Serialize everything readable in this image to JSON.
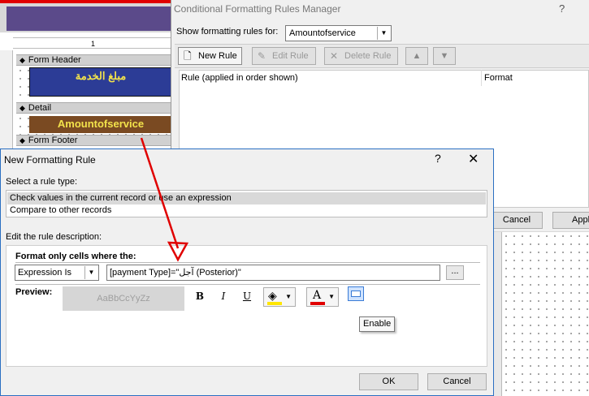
{
  "form_design": {
    "arabic_label": "مبلغ الخدمة",
    "field_label": "Amountofservice",
    "ruler_mark": "1",
    "sections": {
      "header": "Form Header",
      "detail": "Detail",
      "footer": "Form Footer"
    }
  },
  "rules_manager": {
    "title": "Conditional Formatting Rules Manager",
    "help": "?",
    "show_label": "Show formatting rules for:",
    "show_value": "Amountofservice",
    "toolbar": {
      "new_rule": "New Rule",
      "edit_rule": "Edit Rule",
      "delete_rule": "Delete Rule"
    },
    "columns": {
      "rule": "Rule (applied in order shown)",
      "format": "Format"
    },
    "cancel": "Cancel",
    "apply": "Apply"
  },
  "new_rule_dialog": {
    "title": "New Formatting Rule",
    "help": "?",
    "close": "✕",
    "select_rule_type_label": "Select a rule type:",
    "rule_types": [
      "Check values in the current record or use an expression",
      "Compare to other records"
    ],
    "selected_rule_type_index": 0,
    "edit_desc_label": "Edit the rule description:",
    "format_only_label": "Format only cells where the:",
    "condition_type": "Expression Is",
    "expression": "[payment Type]=\"آجل (Posterior)\"",
    "builder_label": "...",
    "preview_label": "Preview:",
    "preview_text": "AaBbCcYyZz",
    "bold": "B",
    "italic": "I",
    "underline": "U",
    "fill_color": "#ffe600",
    "font_color": "#e00000",
    "enable_tooltip": "Enable",
    "ok": "OK",
    "cancel": "Cancel"
  },
  "colors": {
    "header_label_bg": "#2c3c96",
    "label_text": "#f3e34b",
    "field_bg": "#7a4a22",
    "arrow": "#e00000"
  }
}
